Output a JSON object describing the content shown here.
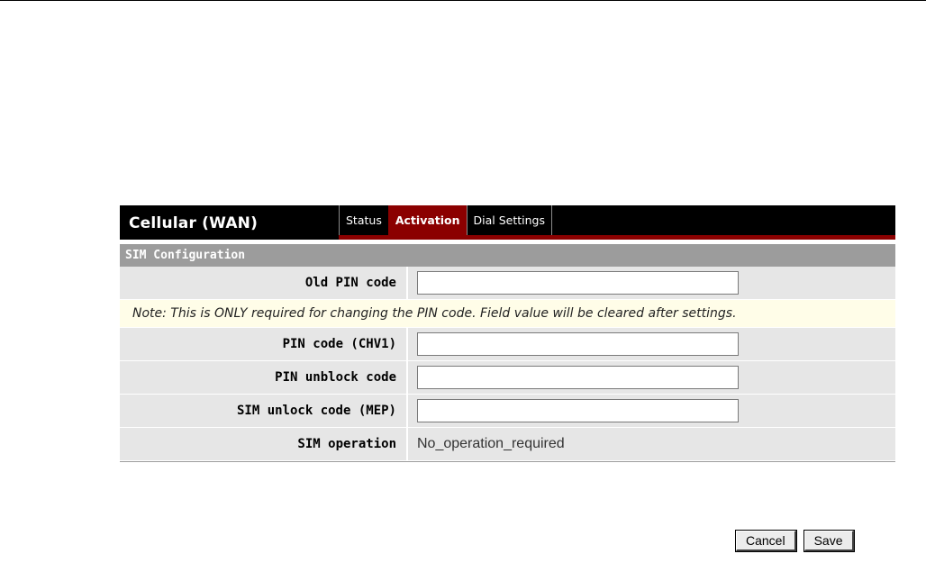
{
  "header": {
    "title": "Cellular (WAN)",
    "tabs": [
      {
        "label": "Status",
        "active": false
      },
      {
        "label": "Activation",
        "active": true
      },
      {
        "label": "Dial Settings",
        "active": false
      }
    ]
  },
  "section": {
    "title": "SIM Configuration"
  },
  "fields": {
    "old_pin": {
      "label": "Old PIN code",
      "value": ""
    },
    "note": "Note: This is ONLY required for changing the PIN code. Field value will be cleared after settings.",
    "pin_code": {
      "label": "PIN code (CHV1)",
      "value": ""
    },
    "pin_unblock": {
      "label": "PIN unblock code",
      "value": ""
    },
    "sim_unlock": {
      "label": "SIM unlock code (MEP)",
      "value": ""
    },
    "sim_operation": {
      "label": "SIM operation",
      "value": "No_operation_required"
    }
  },
  "buttons": {
    "cancel": "Cancel",
    "save": "Save"
  },
  "colors": {
    "accent": "#8b0000",
    "section_bg": "#9c9c9c",
    "row_bg": "#e6e6e6",
    "note_bg": "#fffde8"
  }
}
